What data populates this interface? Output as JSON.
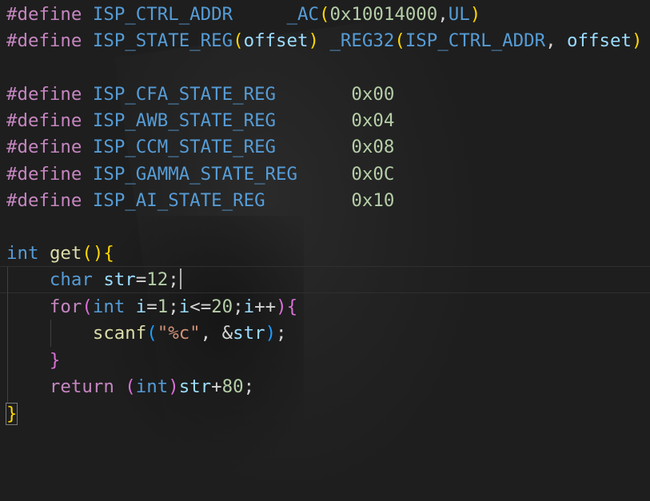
{
  "editor": {
    "lines": {
      "l1": {
        "directive": "#define",
        "name": "ISP_CTRL_ADDR",
        "macro_call": "_AC",
        "open_paren": "(",
        "arg1": "0x10014000",
        "comma": ",",
        "arg2": "UL",
        "close_paren": ")"
      },
      "l2": {
        "directive": "#define",
        "name": "ISP_STATE_REG",
        "open_paren": "(",
        "param": "offset",
        "close_paren": ")",
        "macro_call": "_REG32",
        "open_paren2": "(",
        "arg1": "ISP_CTRL_ADDR",
        "comma": ", ",
        "arg2": "offset",
        "close_paren2": ")"
      },
      "l4": {
        "directive": "#define",
        "name": "ISP_CFA_STATE_REG",
        "value": "0x00"
      },
      "l5": {
        "directive": "#define",
        "name": "ISP_AWB_STATE_REG",
        "value": "0x04"
      },
      "l6": {
        "directive": "#define",
        "name": "ISP_CCM_STATE_REG",
        "value": "0x08"
      },
      "l7": {
        "directive": "#define",
        "name": "ISP_GAMMA_STATE_REG",
        "value": "0x0C"
      },
      "l8": {
        "directive": "#define",
        "name": "ISP_AI_STATE_REG",
        "value": "0x10"
      },
      "l10": {
        "type": "int",
        "fn": "get",
        "parens": "()",
        "brace": "{"
      },
      "l11": {
        "type": "char",
        "var": "str",
        "eq": "=",
        "num": "12",
        "semi": ";"
      },
      "l12": {
        "kw": "for",
        "open": "(",
        "type": "int",
        "var1": "i",
        "eq": "=",
        "num1": "1",
        "semi1": ";",
        "var2": "i",
        "le": "<=",
        "num2": "20",
        "semi2": ";",
        "var3": "i",
        "inc": "++",
        "close": ")",
        "brace": "{"
      },
      "l13": {
        "fn": "scanf",
        "open": "(",
        "str": "\"%c\"",
        "comma": ", ",
        "amp": "&",
        "var": "str",
        "close": ")",
        "semi": ";"
      },
      "l14": {
        "brace": "}"
      },
      "l15": {
        "kw": "return",
        "open": "(",
        "type": "int",
        "close": ")",
        "var": "str",
        "plus": "+",
        "num": "80",
        "semi": ";"
      },
      "l16": {
        "brace": "}"
      }
    }
  }
}
